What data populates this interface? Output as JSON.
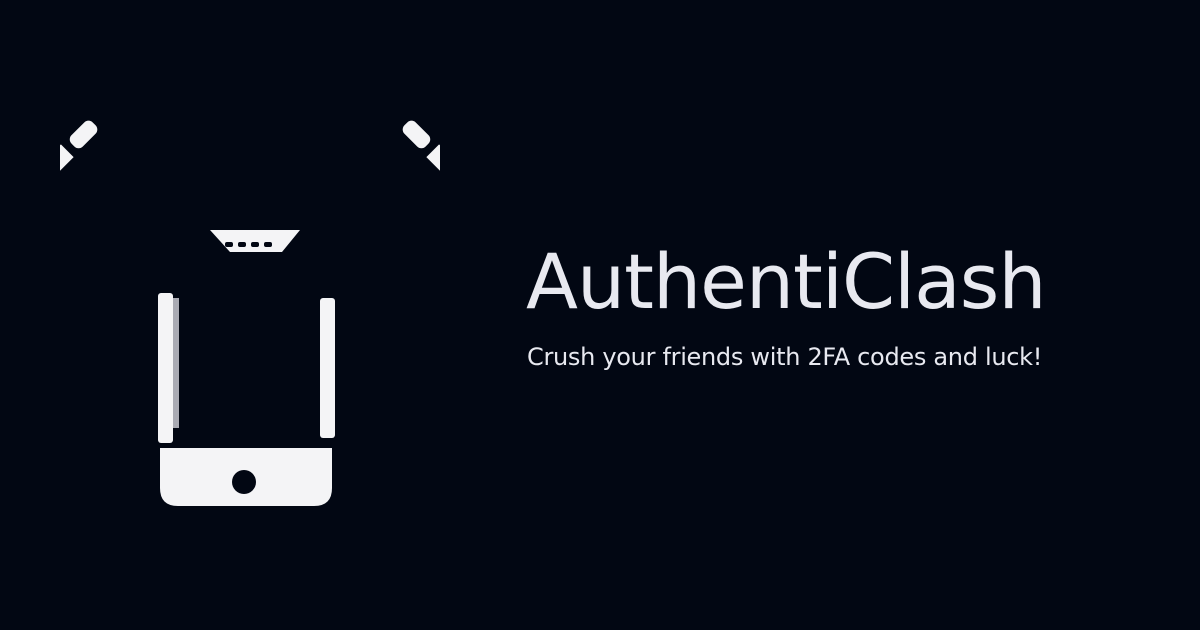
{
  "brand": {
    "title": "AuthentiClash",
    "tagline": "Crush your friends with 2FA codes and luck!",
    "logo_icon": "phone-crossed-swords-icon"
  },
  "colors": {
    "background": "#020713",
    "foreground": "#e8e9f0",
    "logo_light": "#f4f4f6",
    "logo_shade": "#a9aab3"
  }
}
